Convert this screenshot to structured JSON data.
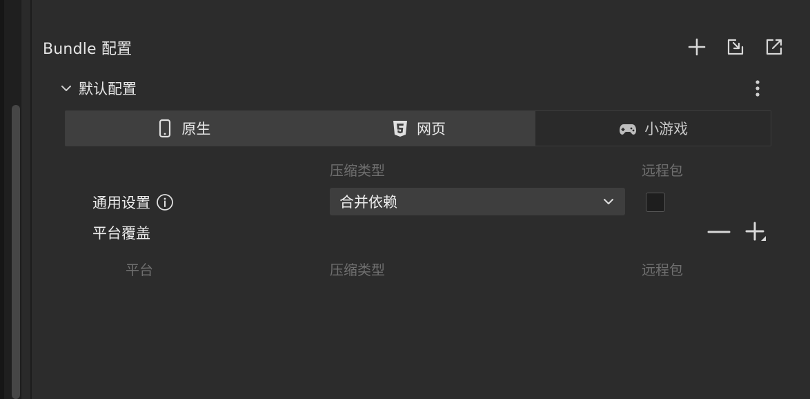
{
  "section": {
    "title": "Bundle 配置"
  },
  "header_icons": [
    "plus-icon",
    "import-icon",
    "export-icon"
  ],
  "group": {
    "title": "默认配置"
  },
  "tabs": [
    {
      "label": "原生",
      "icon": "mobile-phone-icon",
      "active": true
    },
    {
      "label": "网页",
      "icon": "html5-icon",
      "active": true
    },
    {
      "label": "小游戏",
      "icon": "gamepad-icon",
      "active": false
    }
  ],
  "general": {
    "col_compression": "压缩类型",
    "col_remote": "远程包",
    "label": "通用设置",
    "compression_value": "合并依赖",
    "remote_checked": false
  },
  "override": {
    "label": "平台覆盖",
    "col_platform": "平台",
    "col_compression": "压缩类型",
    "col_remote": "远程包"
  },
  "colors": {
    "background": "#2c2c2c",
    "tab_active": "#3f3f3f",
    "muted_text": "#6f6f6f"
  }
}
